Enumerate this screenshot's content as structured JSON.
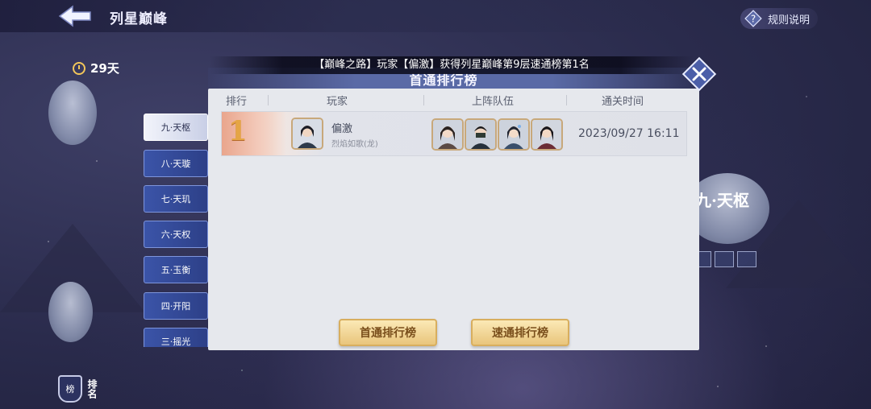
{
  "header": {
    "title": "列星巅峰",
    "rules_label": "规则说明"
  },
  "timer": {
    "value": "29天"
  },
  "floors": [
    {
      "label": "九·天枢",
      "active": true
    },
    {
      "label": "八·天璇",
      "active": false
    },
    {
      "label": "七·天玑",
      "active": false
    },
    {
      "label": "六·天权",
      "active": false
    },
    {
      "label": "五·玉衡",
      "active": false
    },
    {
      "label": "四·开阳",
      "active": false
    },
    {
      "label": "三·摇光",
      "active": false
    }
  ],
  "sidebar": {
    "leaderboard_icon": "榜",
    "leaderboard_label": "排名"
  },
  "background": {
    "stone_label": "九·天枢"
  },
  "modal": {
    "marquee": "【巅峰之路】玩家【偏激】获得列星巅峰第9层速通榜第1名",
    "title": "首通排行榜",
    "columns": {
      "rank": "排行",
      "player": "玩家",
      "team": "上阵队伍",
      "time": "通关时间"
    },
    "rows": [
      {
        "rank": "1",
        "player_name": "偏激",
        "player_title": "烈焰如歌(龙)",
        "clear_time": "2023/09/27 16:11"
      }
    ],
    "buttons": {
      "first_clear": "首通排行榜",
      "speed_clear": "速通排行榜"
    }
  },
  "colors": {
    "accent_gold": "#e9c57c",
    "tab_blue": "#3b54a8",
    "rank_gold": "#e5a545"
  }
}
